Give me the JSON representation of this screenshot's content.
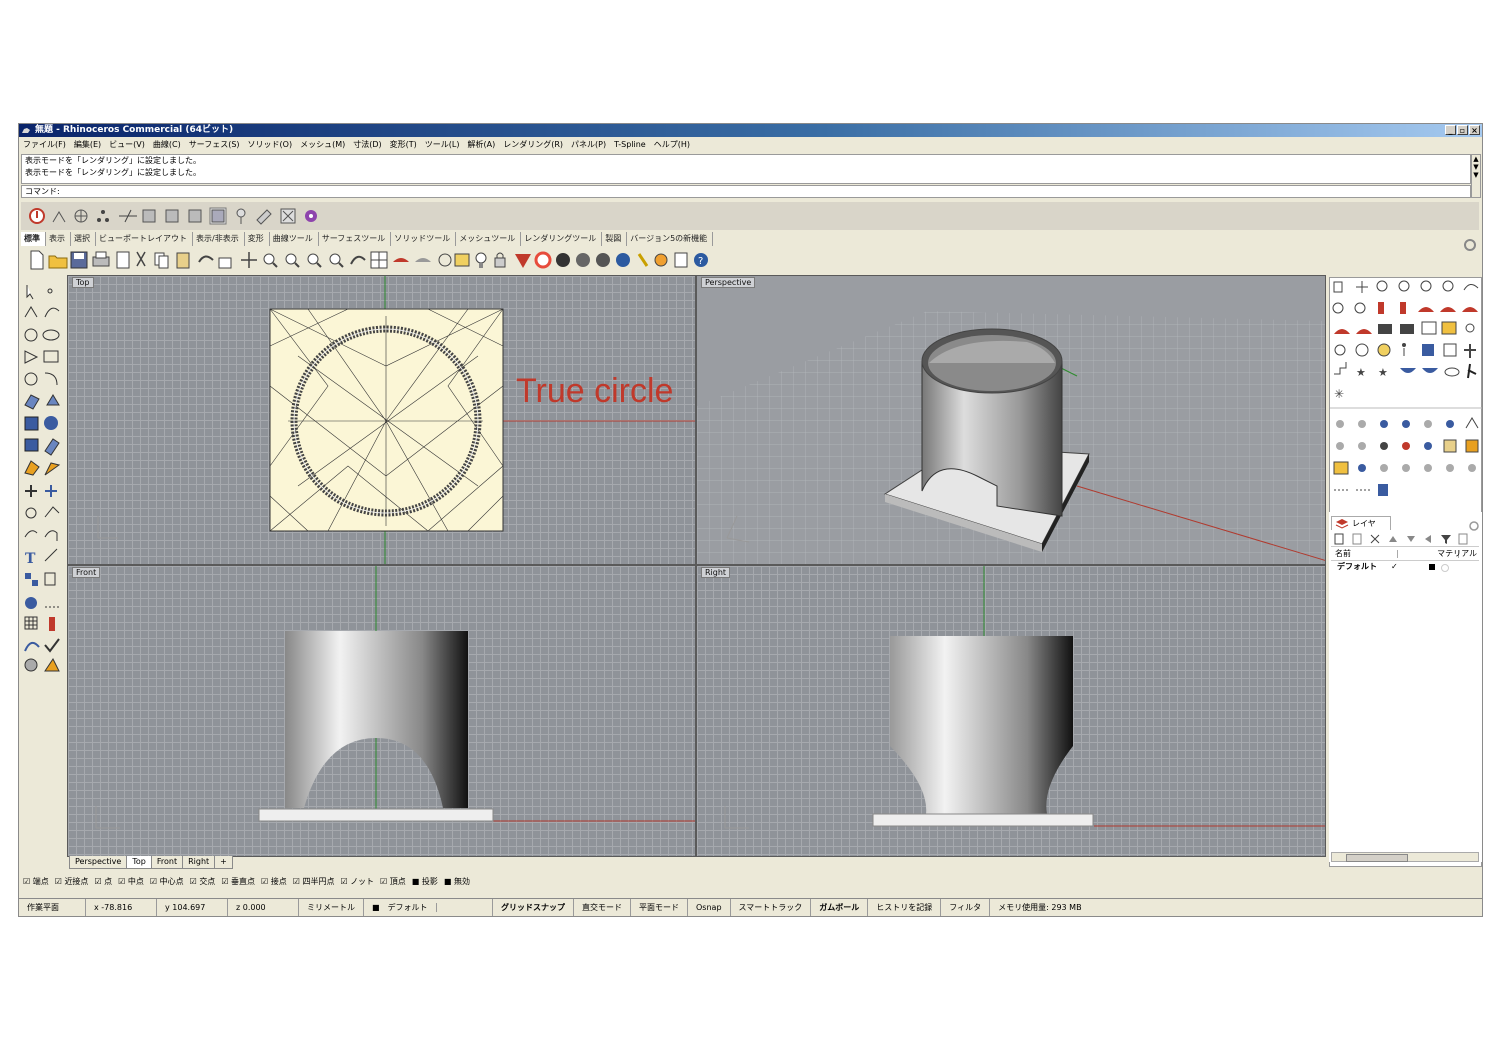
{
  "window": {
    "title": "無題 - Rhinoceros Commercial (64ビット)",
    "buttons": [
      "_",
      "▫",
      "×"
    ]
  },
  "menu": [
    "ファイル(F)",
    "編集(E)",
    "ビュー(V)",
    "曲線(C)",
    "サーフェス(S)",
    "ソリッド(O)",
    "メッシュ(M)",
    "寸法(D)",
    "変形(T)",
    "ツール(L)",
    "解析(A)",
    "レンダリング(R)",
    "パネル(P)",
    "T-Spline",
    "ヘルプ(H)"
  ],
  "command": {
    "history": [
      "表示モードを「レンダリング」に設定しました。",
      "表示モードを「レンダリング」に設定しました。"
    ],
    "prompt": "コマンド:"
  },
  "toolbar_tabs": [
    "標準",
    "表示",
    "選択",
    "ビューポートレイアウト",
    "表示/非表示",
    "変形",
    "曲線ツール",
    "サーフェスツール",
    "ソリッドツール",
    "メッシュツール",
    "レンダリングツール",
    "製図",
    "バージョン5の新機能"
  ],
  "active_toolbar_tab": "標準",
  "viewports": {
    "top": "Top",
    "perspective": "Perspective",
    "front": "Front",
    "right": "Right"
  },
  "annotation": "True circle",
  "viewport_tabs": [
    "Perspective",
    "Top",
    "Front",
    "Right"
  ],
  "viewport_tab_add": "+",
  "layers": {
    "tab": "レイヤ",
    "col_name": "名前",
    "col_material": "マテリアル",
    "row_name": "デフォルト",
    "row_check": "✓"
  },
  "osnap": [
    "端点",
    "近接点",
    "点",
    "中点",
    "中心点",
    "交点",
    "垂直点",
    "接点",
    "四半円点",
    "ノット",
    "頂点",
    "投影",
    "無効"
  ],
  "status": {
    "plane": "作業平面",
    "x": "x -78.816",
    "y": "y 104.697",
    "z": "z 0.000",
    "units": "ミリメートル",
    "layer": "デフォルト",
    "grid_snap": "グリッドスナップ",
    "ortho": "直交モード",
    "planar": "平面モード",
    "osnap": "Osnap",
    "smarttrack": "スマートトラック",
    "gumball": "ガムボール",
    "history": "ヒストリを記録",
    "filter": "フィルタ",
    "memory": "メモリ使用量: 293 MB"
  },
  "colors": {
    "annotation": "#c0392b",
    "viewport_bg": "#8f9399",
    "axis_x": "#b03a2e",
    "axis_y": "#2e8b2e"
  }
}
